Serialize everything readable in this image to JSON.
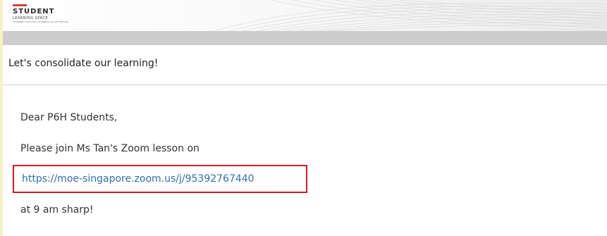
{
  "banner": {
    "logo_title": "STUDENT",
    "logo_subtitle": "LEARNING SPACE",
    "logo_tagline": "LEARNING FOR LIFE, LEARNING IN LIFE SPACES"
  },
  "colors": {
    "page_border": "#f6f2c4",
    "grey_band": "#cdcdcd",
    "link": "#2f6fb2",
    "highlight_box": "#d8181f",
    "logo_accent": "#d83a3a"
  },
  "page": {
    "heading": "Let's consolidate our learning!"
  },
  "message": {
    "greeting": "Dear P6H Students,",
    "invite": "Please join Ms Tan's Zoom lesson on",
    "link_text": "https://moe-singapore.zoom.us/j/95392767440",
    "time": "at 9 am sharp!"
  }
}
